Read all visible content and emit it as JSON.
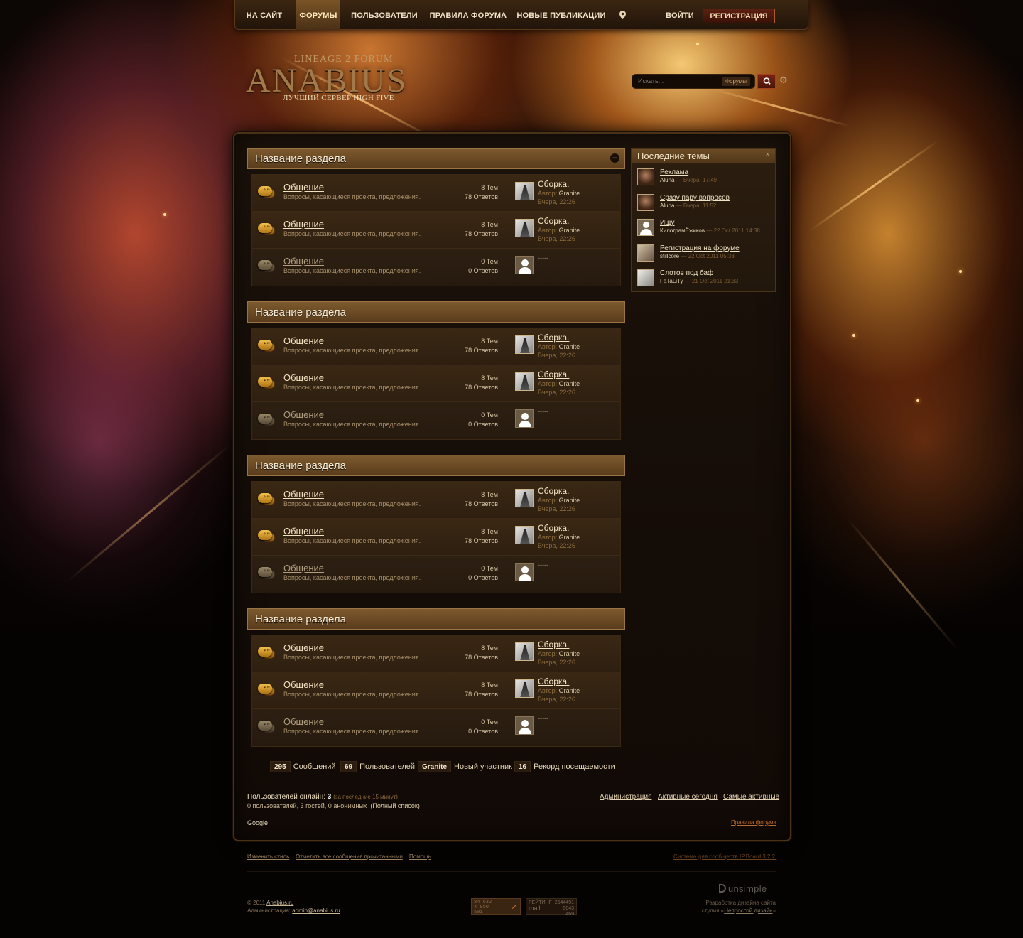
{
  "nav": {
    "items": [
      "НА САЙТ",
      "ФОРУМЫ",
      "ПОЛЬЗОВАТЕЛИ",
      "ПРАВИЛА ФОРУМА",
      "НОВЫЕ ПУБЛИКАЦИИ"
    ],
    "login": "ВОЙТИ",
    "register": "РЕГИСТРАЦИЯ"
  },
  "logo": {
    "sub": "LINEAGE 2 FORUM",
    "main": "ANABIUS",
    "tag": "ЛУЧШИЙ СЕРВЕР HIGH FIVE"
  },
  "search": {
    "placeholder": "Искать...",
    "scope": "Форумы"
  },
  "sections": [
    {
      "title": "Название раздела"
    },
    {
      "title": "Название раздела"
    },
    {
      "title": "Название раздела"
    },
    {
      "title": "Название раздела"
    }
  ],
  "forum_row": {
    "title": "Общение",
    "desc": "Вопросы, касающиеся проекта, предложения.",
    "topics": "8 Тем",
    "replies": "78 Ответов",
    "topics_empty": "0 Тем",
    "replies_empty": "0 Ответов",
    "last_title": "Сборка.",
    "author_label": "Автор:",
    "author": "Granite",
    "last_date": "Вчера, 22:26",
    "none": "-----"
  },
  "sidebar": {
    "title": "Последние темы",
    "close": "×",
    "topics": [
      {
        "title": "Реклама",
        "author": "Aluna",
        "date": "— Вчера, 17:49"
      },
      {
        "title": "Сразу пару вопросов",
        "author": "Aluna",
        "date": "— Вчера, 11:52"
      },
      {
        "title": "Ищу",
        "author": "КилограмЁжиков",
        "date": "— 22 Oct 2011 14:38"
      },
      {
        "title": "Регистрация на форуме",
        "author": "stillcore",
        "date": "— 22 Oct 2011 05:33"
      },
      {
        "title": "Слотов под баф",
        "author": "FaTaLiTy",
        "date": "— 21 Oct 2011 21:33"
      }
    ]
  },
  "stats": [
    {
      "num": "295",
      "label": "Сообщений"
    },
    {
      "num": "69",
      "label": "Пользователей"
    },
    {
      "num": "Granite",
      "label": "Новый участник"
    },
    {
      "num": "16",
      "label": "Рекорд посещаемости"
    }
  ],
  "online": {
    "title": "Пользователей онлайн:",
    "count": "3",
    "note": "(за последние 15 минут)",
    "list": "0 пользователей, 3 гостей, 0 анонимных",
    "full": "(Полный список)"
  },
  "links_right": [
    "Администрация",
    "Активные сегодня",
    "Самые активные"
  ],
  "google": "Google",
  "rules": "Правила форума",
  "footer": {
    "change_style": "Изменить стиль",
    "mark_read": "Отметить все сообщения прочитанными",
    "help": "Помощь",
    "ipb": "Система для сообществ IP.Board 3.2.2.",
    "copyright": "© 2011",
    "site": "Anabius.ru",
    "admin_label": "Администрация:",
    "admin_email": "admin@anabius.ru",
    "counter1": [
      "84 632",
      "4 950",
      "501"
    ],
    "counter2_label": "РЕЙТИНГ",
    "counter2_site": "mail",
    "counter2_vals": [
      "2544491",
      "5043",
      "469"
    ],
    "unsimple": "unsimple",
    "studio_line1": "Разработка дизайна сайта",
    "studio_line2": "студия «",
    "studio_name": "Непростой дизайн",
    "studio_end": "»"
  }
}
